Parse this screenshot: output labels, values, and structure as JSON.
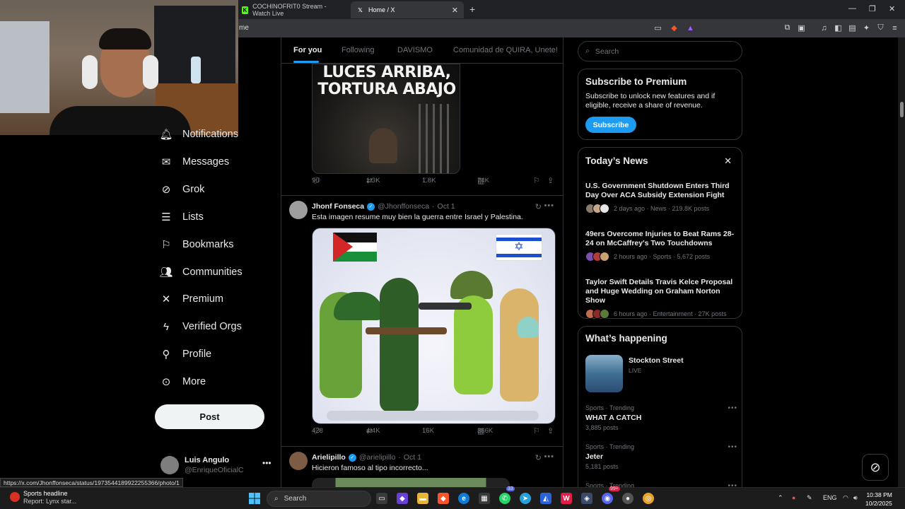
{
  "browser": {
    "tabs": [
      {
        "title": "COCHINOFRIT0 Stream - Watch Live",
        "icon": "kick-icon",
        "color": "#53fc18"
      },
      {
        "title": "Home / X",
        "icon": "x-logo-icon",
        "color": "#ffffff"
      }
    ],
    "address_fragment": "me"
  },
  "nav": {
    "items": [
      {
        "label": "Notifications",
        "icon": "bell-icon"
      },
      {
        "label": "Messages",
        "icon": "envelope-icon"
      },
      {
        "label": "Grok",
        "icon": "grok-icon"
      },
      {
        "label": "Lists",
        "icon": "list-icon"
      },
      {
        "label": "Bookmarks",
        "icon": "bookmark-icon"
      },
      {
        "label": "Communities",
        "icon": "people-icon"
      },
      {
        "label": "Premium",
        "icon": "x-logo-icon"
      },
      {
        "label": "Verified Orgs",
        "icon": "lightning-icon"
      },
      {
        "label": "Profile",
        "icon": "person-icon"
      },
      {
        "label": "More",
        "icon": "more-circle-icon"
      }
    ],
    "post_label": "Post",
    "account": {
      "name": "Luis Angulo",
      "handle": "@EnriqueOficialC"
    }
  },
  "feed": {
    "tabs": [
      "For you",
      "Following",
      "DAVISMO",
      "Comunidad de QUIRA, Unete!"
    ],
    "active_tab": 0,
    "tweet1": {
      "image_text_1": "LUCES ARRIBA,",
      "image_text_2": "TORTURA ABAJO",
      "replies": "90",
      "reposts": "1.3K",
      "likes": "1.8K",
      "views": "74K"
    },
    "tweet2": {
      "name": "Jhonf Fonseca",
      "handle": "@Jhonffonseca",
      "time": "Oct 1",
      "text": "Esta imagen resume muy bien la guerra entre Israel y Palestina.",
      "replies": "428",
      "reposts": "4.4K",
      "likes": "16K",
      "views": "366K"
    },
    "tweet3": {
      "name": "Arielipillo",
      "handle": "@arielipillo",
      "time": "Oct 1",
      "text": "Hicieron famoso al tipo incorrecto..."
    }
  },
  "sidebar": {
    "search_placeholder": "Search",
    "premium": {
      "title": "Subscribe to Premium",
      "desc": "Subscribe to unlock new features and if eligible, receive a share of revenue.",
      "button": "Subscribe"
    },
    "news": {
      "title": "Today’s News",
      "items": [
        {
          "title": "U.S. Government Shutdown Enters Third Day Over ACA Subsidy Extension Fight",
          "meta": "2 days ago · News · 219.8K posts"
        },
        {
          "title": "49ers Overcome Injuries to Beat Rams 28-24 on McCaffrey's Two Touchdowns",
          "meta": "2 hours ago · Sports · 5,672 posts"
        },
        {
          "title": "Taylor Swift Details Travis Kelce Proposal and Huge Wedding on Graham Norton Show",
          "meta": "6 hours ago · Entertainment · 27K posts"
        }
      ]
    },
    "happening": {
      "title": "What’s happening",
      "live": {
        "title": "Stockton Street",
        "status": "LIVE"
      },
      "trends": [
        {
          "category": "Sports · Trending",
          "name": "WHAT A CATCH",
          "posts": "3,885 posts"
        },
        {
          "category": "Sports · Trending",
          "name": "Jeter",
          "posts": "5,181 posts"
        },
        {
          "category": "Sports · Trending",
          "name": "",
          "posts": ""
        }
      ]
    }
  },
  "status_url": "https://x.com/Jhonffonseca/status/1973544189922255366/photo/1",
  "taskbar": {
    "widget_title": "Sports headline",
    "widget_sub": "Report: Lynx star...",
    "search_label": "Search",
    "lang": "ENG",
    "time": "10:38 PM",
    "date": "10/2/2025",
    "badge1": "33",
    "badge2": "99+"
  }
}
